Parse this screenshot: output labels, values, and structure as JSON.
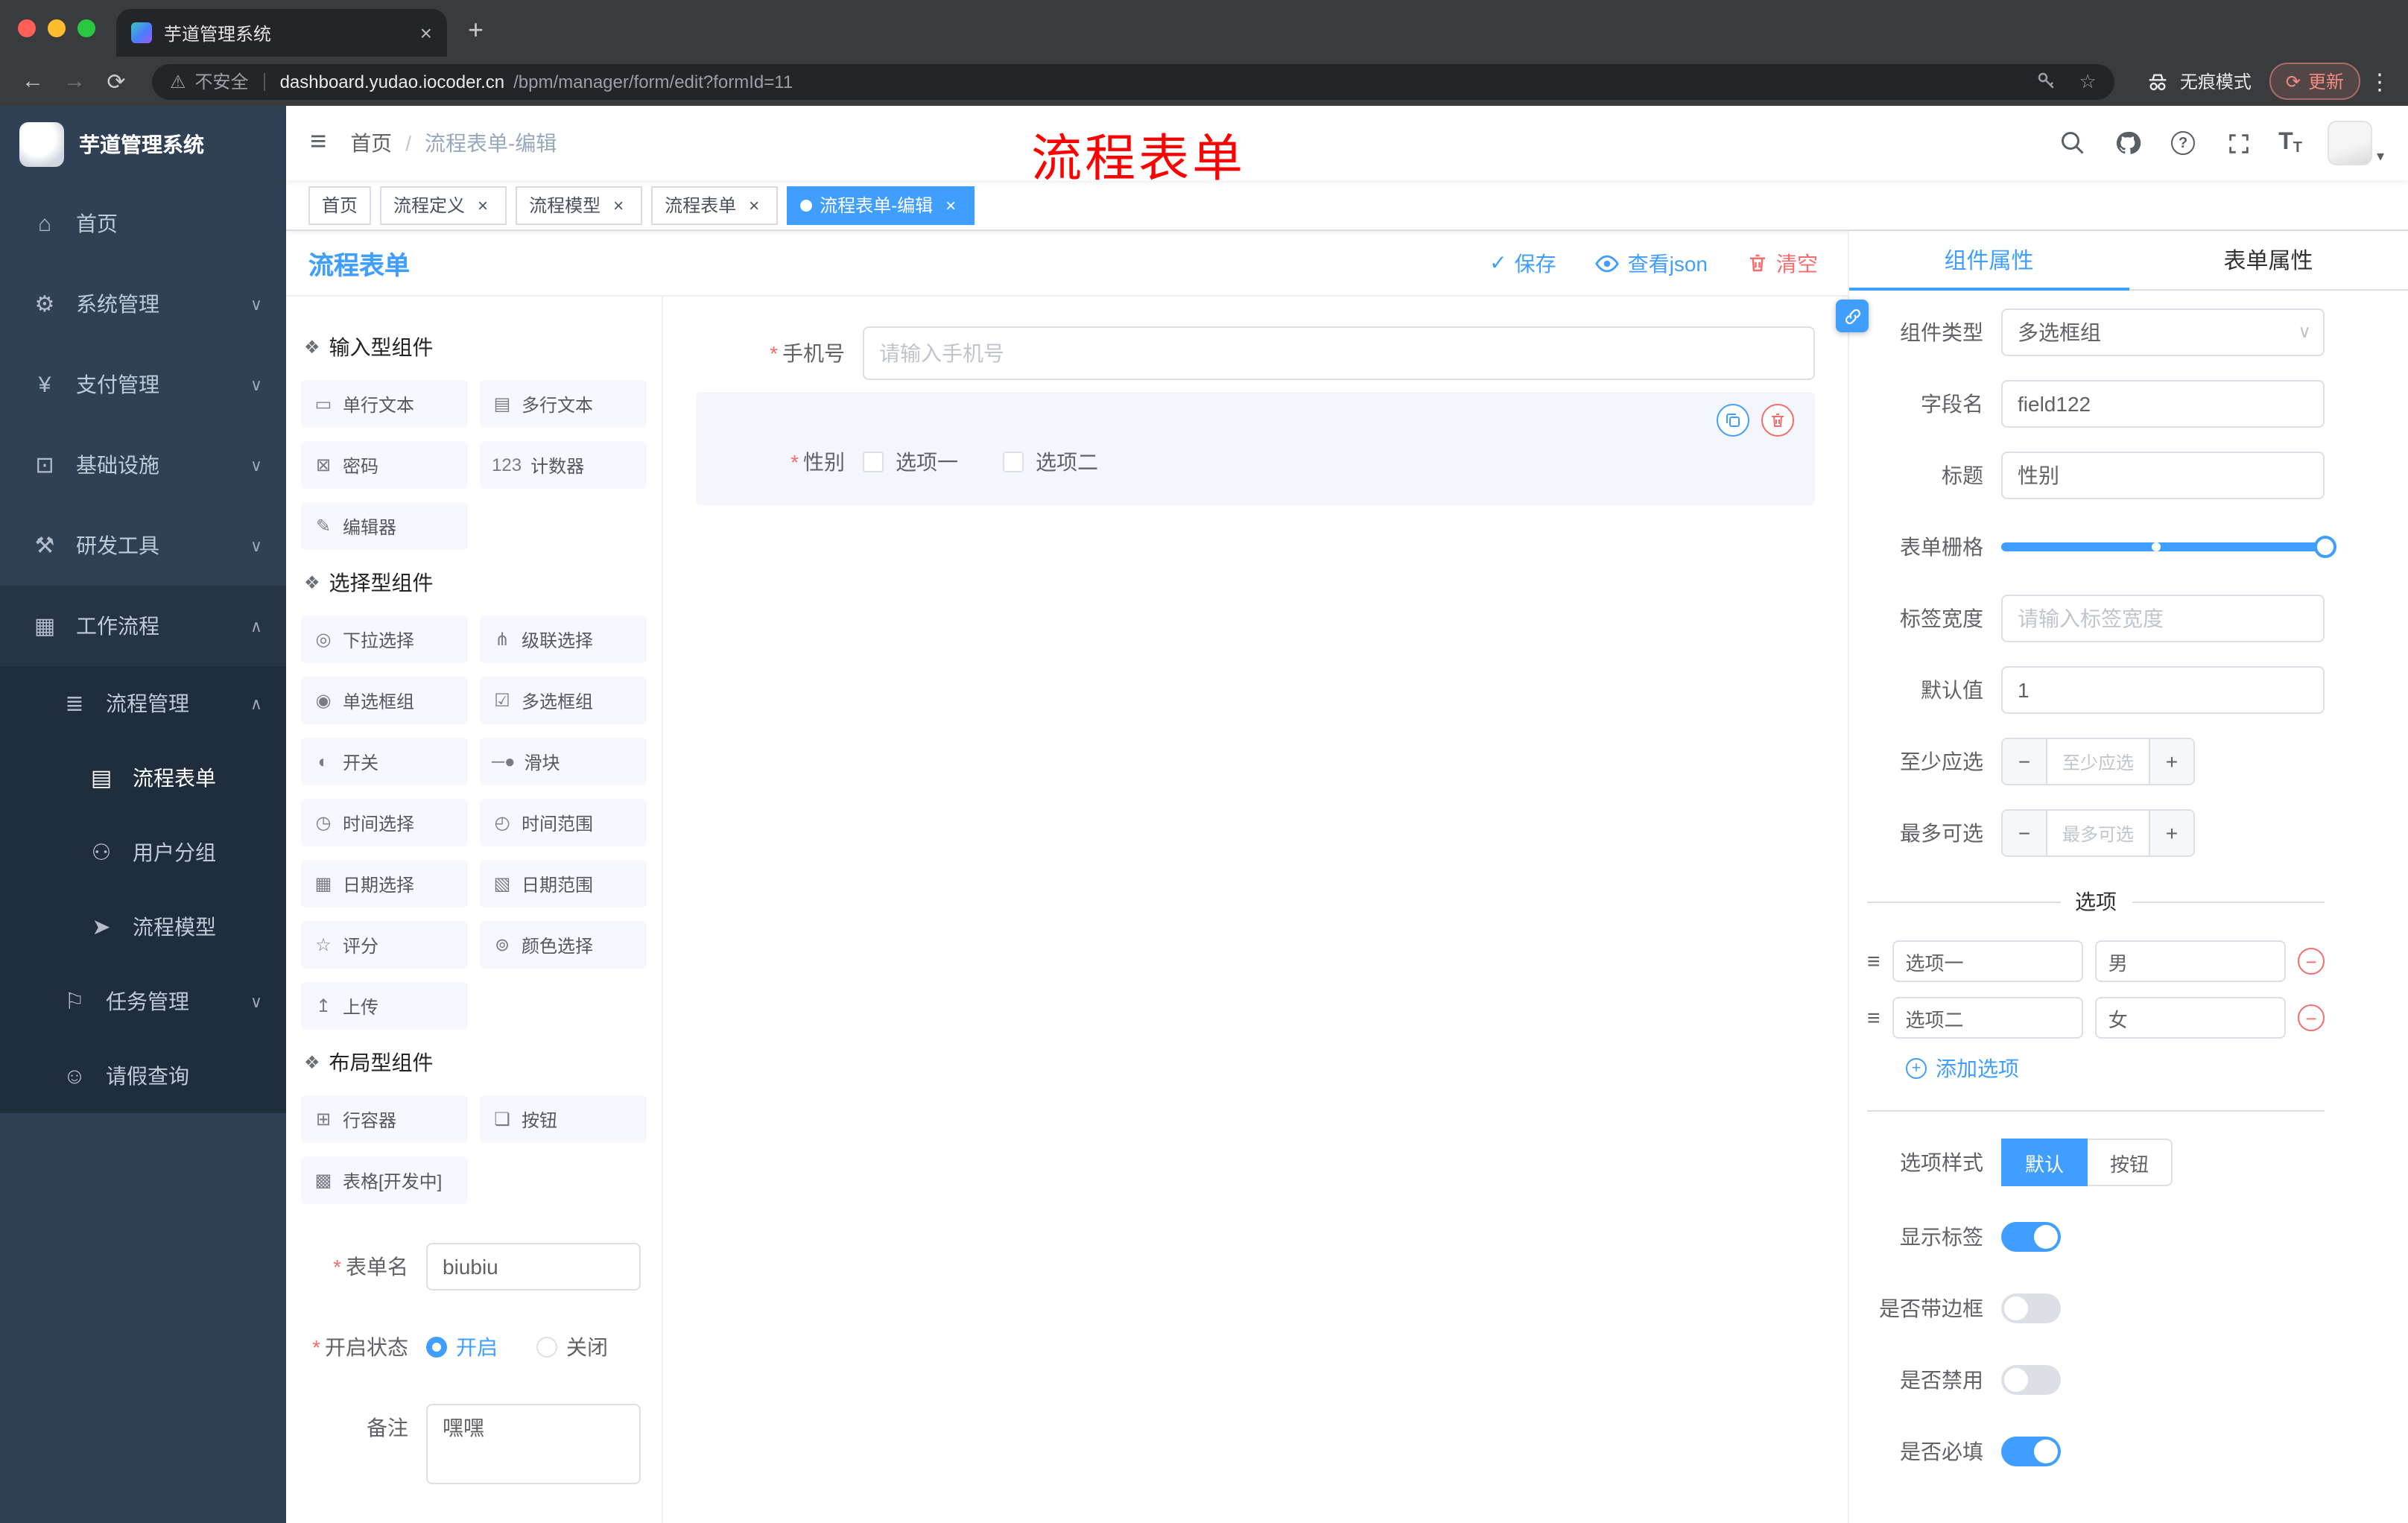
{
  "icons": {
    "close": "×",
    "plus": "+",
    "back": "←",
    "forward": "→",
    "reload": "⟳",
    "warning": "⚠",
    "star": "☆",
    "dots": "⋮",
    "hamburger": "≡",
    "caret_down": "∨",
    "avatar_caret": "▾",
    "check": "✓",
    "minus": "−",
    "help": "?",
    "size": "T",
    "group": "❖",
    "drag": "≡"
  },
  "browser": {
    "tab_title": "芋道管理系统",
    "security_label": "不安全",
    "url_host": "dashboard.yudao.iocoder.cn",
    "url_path": "/bpm/manager/form/edit?formId=11",
    "incognito_label": "无痕模式",
    "update_label": "更新"
  },
  "sidebar": {
    "app_title": "芋道管理系统",
    "items": [
      {
        "label": "首页",
        "icon": "⌂",
        "icon_name": "home-icon",
        "cls": "lvl1"
      },
      {
        "label": "系统管理",
        "icon": "⚙",
        "icon_name": "system-icon",
        "cls": "lvl1",
        "chevron": "∨"
      },
      {
        "label": "支付管理",
        "icon": "¥",
        "icon_name": "payment-icon",
        "cls": "lvl1",
        "chevron": "∨"
      },
      {
        "label": "基础设施",
        "icon": "⊡",
        "icon_name": "infrastructure-icon",
        "cls": "lvl1",
        "chevron": "∨"
      },
      {
        "label": "研发工具",
        "icon": "⚒",
        "icon_name": "devtools-icon",
        "cls": "lvl1",
        "chevron": "∨"
      },
      {
        "label": "工作流程",
        "icon": "▦",
        "icon_name": "workflow-icon",
        "cls": "lvl1 open",
        "chevron": "∧"
      },
      {
        "label": "流程管理",
        "icon": "≣",
        "icon_name": "process-management-icon",
        "cls": "lvl2 sub",
        "chevron": "∧"
      },
      {
        "label": "流程表单",
        "icon": "▤",
        "icon_name": "process-form-icon",
        "cls": "lvl3 sub active"
      },
      {
        "label": "用户分组",
        "icon": "⚇",
        "icon_name": "user-group-icon",
        "cls": "lvl3 sub"
      },
      {
        "label": "流程模型",
        "icon": "➤",
        "icon_name": "process-model-icon",
        "cls": "lvl3 sub"
      },
      {
        "label": "任务管理",
        "icon": "⚐",
        "icon_name": "task-management-icon",
        "cls": "lvl2 sub",
        "chevron": "∨"
      },
      {
        "label": "请假查询",
        "icon": "☺",
        "icon_name": "leave-query-icon",
        "cls": "lvl2 sub"
      }
    ]
  },
  "navbar": {
    "breadcrumb_home": "首页",
    "breadcrumb_sep": "/",
    "breadcrumb_current": "流程表单-编辑",
    "annotation": "流程表单"
  },
  "tags": [
    {
      "label": "首页"
    },
    {
      "label": "流程定义",
      "close": "×"
    },
    {
      "label": "流程模型",
      "close": "×"
    },
    {
      "label": "流程表单",
      "close": "×"
    },
    {
      "label": "流程表单-编辑",
      "close": "×",
      "cls": "active"
    }
  ],
  "designer": {
    "title": "流程表单",
    "required_mark": "*",
    "save_label": "保存",
    "view_json_label": "查看json",
    "clear_label": "清空",
    "group_input": {
      "title": "输入型组件",
      "items": [
        {
          "label": "单行文本",
          "icon": "▭",
          "icon_name": "single-line-text-icon"
        },
        {
          "label": "多行文本",
          "icon": "▤",
          "icon_name": "multi-line-text-icon"
        },
        {
          "label": "密码",
          "icon": "⊠",
          "icon_name": "password-icon"
        },
        {
          "label": "计数器",
          "icon": "123",
          "icon_name": "counter-icon"
        },
        {
          "label": "编辑器",
          "icon": "✎",
          "icon_name": "editor-icon"
        }
      ]
    },
    "group_select": {
      "title": "选择型组件",
      "items": [
        {
          "label": "下拉选择",
          "icon": "◎",
          "icon_name": "dropdown-select-icon"
        },
        {
          "label": "级联选择",
          "icon": "⋔",
          "icon_name": "cascade-select-icon"
        },
        {
          "label": "单选框组",
          "icon": "◉",
          "icon_name": "radio-group-icon"
        },
        {
          "label": "多选框组",
          "icon": "☑",
          "icon_name": "checkbox-group-icon"
        },
        {
          "label": "开关",
          "icon": "◐",
          "icon_name": "switch-icon"
        },
        {
          "label": "滑块",
          "icon": "─●",
          "icon_name": "slider-icon"
        },
        {
          "label": "时间选择",
          "icon": "◷",
          "icon_name": "time-picker-icon"
        },
        {
          "label": "时间范围",
          "icon": "◴",
          "icon_name": "time-range-icon"
        },
        {
          "label": "日期选择",
          "icon": "▦",
          "icon_name": "date-picker-icon"
        },
        {
          "label": "日期范围",
          "icon": "▧",
          "icon_name": "date-range-icon"
        },
        {
          "label": "评分",
          "icon": "☆",
          "icon_name": "rate-icon"
        },
        {
          "label": "颜色选择",
          "icon": "⊚",
          "icon_name": "color-picker-icon"
        },
        {
          "label": "上传",
          "icon": "↥",
          "icon_name": "upload-icon"
        }
      ]
    },
    "group_layout": {
      "title": "布局型组件",
      "items": [
        {
          "label": "行容器",
          "icon": "⊞",
          "icon_name": "row-container-icon"
        },
        {
          "label": "按钮",
          "icon": "❏",
          "icon_name": "button-icon"
        },
        {
          "label": "表格[开发中]",
          "icon": "▩",
          "icon_name": "table-icon"
        }
      ]
    },
    "meta": {
      "form_name_label": "表单名",
      "form_name_value": "biubiu",
      "status_label": "开启状态",
      "status_on": "开启",
      "status_off": "关闭",
      "remark_label": "备注",
      "remark_value": "嘿嘿"
    },
    "canvas": {
      "phone_label": "手机号",
      "phone_placeholder": "请输入手机号",
      "gender_label": "性别",
      "gender_options": [
        {
          "label": "选项一"
        },
        {
          "label": "选项二"
        }
      ]
    }
  },
  "props": {
    "tab_component": "组件属性",
    "tab_form": "表单属性",
    "rows": {
      "component_type_label": "组件类型",
      "component_type_value": "多选框组",
      "field_name_label": "字段名",
      "field_name_value": "field122",
      "title_label": "标题",
      "title_value": "性别",
      "grid_label": "表单栅格",
      "label_width_label": "标签宽度",
      "label_width_placeholder": "请输入标签宽度",
      "default_label": "默认值",
      "default_value": "1",
      "min_label": "至少应选",
      "min_placeholder": "至少应选",
      "max_label": "最多可选",
      "max_placeholder": "最多可选"
    },
    "options": {
      "divider": "选项",
      "rows": [
        {
          "label": "选项一",
          "value": "男"
        },
        {
          "label": "选项二",
          "value": "女"
        }
      ],
      "add_label": "添加选项"
    },
    "style": {
      "label": "选项样式",
      "options": [
        {
          "label": "默认",
          "cls": "active"
        },
        {
          "label": "按钮"
        }
      ],
      "toggles": [
        {
          "label": "显示标签",
          "cls": "on"
        },
        {
          "label": "是否带边框"
        },
        {
          "label": "是否禁用"
        },
        {
          "label": "是否必填",
          "cls": "on"
        }
      ]
    }
  }
}
